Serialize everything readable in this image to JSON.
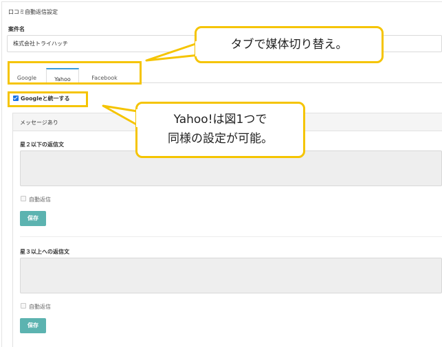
{
  "page": {
    "title": "口コミ自動返信設定",
    "case_label": "案件名",
    "case_value": "株式会社トライハッチ"
  },
  "tabs": [
    {
      "label": "Google",
      "active": false
    },
    {
      "label": "Yahoo",
      "active": true
    },
    {
      "label": "Facebook",
      "active": false
    }
  ],
  "unify": {
    "label": "Googleと統一する",
    "checked": true
  },
  "message_card": {
    "header": "メッセージあり",
    "sections": [
      {
        "label": "星２以下の返信文",
        "textarea_value": "",
        "auto_reply_label": "自動返信",
        "auto_reply_checked": false,
        "save_label": "保存"
      },
      {
        "label": "星３以上への返信文",
        "textarea_value": "",
        "auto_reply_label": "自動返信",
        "auto_reply_checked": false,
        "save_label": "保存"
      }
    ]
  },
  "callouts": {
    "tabs_note": "タブで媒体切り替え。",
    "yahoo_note_line1": "Yahoo!は図1つで",
    "yahoo_note_line2": "同様の設定が可能。"
  },
  "colors": {
    "highlight": "#f5c400",
    "save_button": "#5cb3b0",
    "active_tab": "#3a9bd9",
    "checkbox": "#1a73e8"
  }
}
